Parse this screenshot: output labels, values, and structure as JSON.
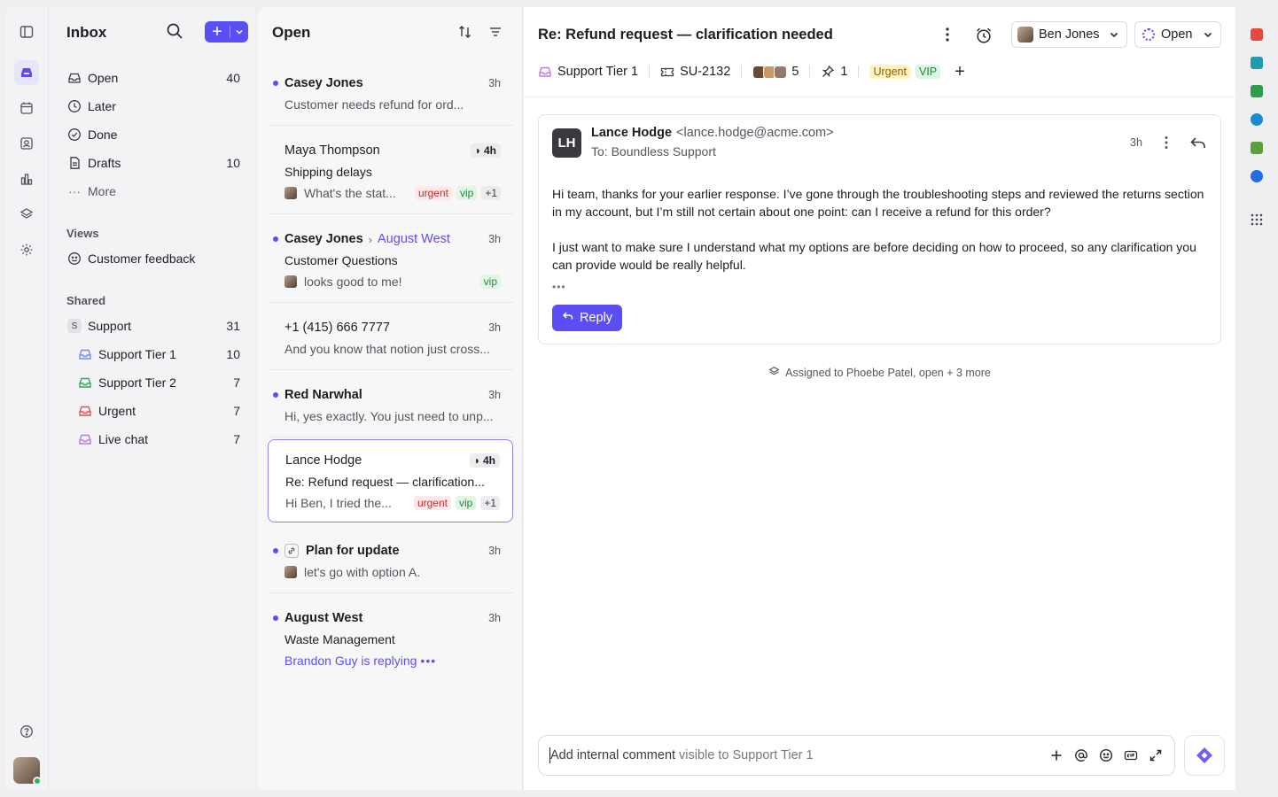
{
  "colors": {
    "accent": "#5b4ef5",
    "urgent": "#c62828",
    "vip": "#1b8a3c"
  },
  "sidebar": {
    "title": "Inbox",
    "items": [
      {
        "label": "Open",
        "count": "40",
        "icon": "inbox-icon"
      },
      {
        "label": "Later",
        "count": "",
        "icon": "clock-icon"
      },
      {
        "label": "Done",
        "count": "",
        "icon": "check-circle-icon"
      },
      {
        "label": "Drafts",
        "count": "10",
        "icon": "document-icon"
      },
      {
        "label": "More",
        "count": "",
        "icon": "ellipsis-icon"
      }
    ],
    "views_label": "Views",
    "views": [
      {
        "label": "Customer feedback",
        "icon": "smile-icon"
      }
    ],
    "shared_label": "Shared",
    "shared": {
      "badge": "S",
      "label": "Support",
      "count": "31"
    },
    "shared_items": [
      {
        "label": "Support Tier 1",
        "count": "10",
        "color": "#7b86e8"
      },
      {
        "label": "Support Tier 2",
        "count": "7",
        "color": "#2fa65a"
      },
      {
        "label": "Urgent",
        "count": "7",
        "color": "#e0524f"
      },
      {
        "label": "Live chat",
        "count": "7",
        "color": "#c47ae0"
      }
    ]
  },
  "list": {
    "title": "Open",
    "conversations": [
      {
        "name": "Casey Jones",
        "time": "3h",
        "preview": "Customer needs refund for ord..."
      },
      {
        "name": "Maya Thompson",
        "time": "4h",
        "subject": "Shipping delays",
        "preview": "What's the stat...",
        "tags": [
          "urgent",
          "vip",
          "+1"
        ]
      },
      {
        "name": "Casey Jones",
        "to": "August West",
        "time": "3h",
        "subject": "Customer Questions",
        "preview": "looks good to me!",
        "tags": [
          "vip"
        ]
      },
      {
        "name": "+1 (415) 666 7777",
        "time": "3h",
        "preview": "And you know that notion just cross..."
      },
      {
        "name": "Red Narwhal",
        "time": "3h",
        "preview": "Hi, yes exactly. You just need to unp..."
      },
      {
        "name": "Lance Hodge",
        "time": "4h",
        "subject": "Re: Refund request — clarification...",
        "preview": "Hi Ben, I tried the...",
        "tags": [
          "urgent",
          "vip",
          "+1"
        ]
      },
      {
        "name": "Plan for update",
        "time": "3h",
        "preview": "let's go with option A."
      },
      {
        "name": "August West",
        "time": "3h",
        "subject": "Waste Management",
        "typing": "Brandon Guy is replying"
      }
    ]
  },
  "main": {
    "title": "Re: Refund request — clarification needed",
    "assignee": "Ben Jones",
    "status": "Open",
    "inbox": "Support Tier 1",
    "ticket": "SU-2132",
    "participants": "5",
    "pins": "1",
    "chips": [
      "Urgent",
      "VIP"
    ],
    "message": {
      "initials": "LH",
      "sender": "Lance Hodge",
      "email": "<lance.hodge@acme.com>",
      "to": "To: Boundless Support",
      "time": "3h",
      "p1": "Hi team, thanks for your earlier response. I’ve gone through the troubleshooting steps and reviewed the returns section in my account, but I’m still not certain about one point: can I receive a refund for this order?",
      "p2": "I just want to make sure I understand what my options are before deciding on how to proceed, so any clarification you can provide would be really helpful.",
      "reply_label": "Reply"
    },
    "assignment_note": "Assigned to Phoebe Patel, open + 3 more",
    "composer": {
      "placeholder_strong": "Add internal comment",
      "placeholder_soft": "visible to Support Tier 1"
    }
  }
}
